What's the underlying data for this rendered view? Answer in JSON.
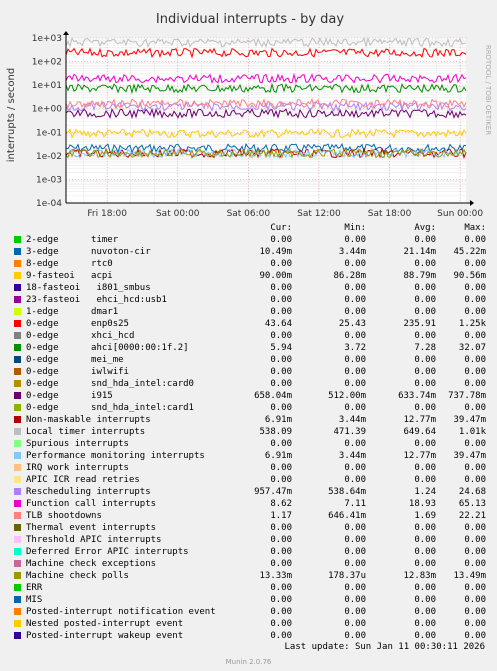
{
  "chart_data": {
    "type": "line",
    "title": "Individual interrupts - by day",
    "ylabel": "interrupts / second",
    "yscale": "log",
    "ylim": [
      0.0001,
      1000
    ],
    "ytick_labels": [
      "1e+03",
      "1e+02",
      "1e+01",
      "1e+00",
      "1e-01",
      "1e-02",
      "1e-03",
      "1e-04"
    ],
    "ytick_values": [
      1000,
      100,
      10,
      1,
      0.1,
      0.01,
      0.001,
      0.0001
    ],
    "xtick_labels": [
      "Fri 18:00",
      "Sat 00:00",
      "Sat 06:00",
      "Sat 12:00",
      "Sat 18:00",
      "Sun 00:00"
    ],
    "xtick_hours": [
      18,
      24,
      30,
      36,
      42,
      48
    ],
    "x_range_hours": [
      14.5,
      48.5
    ],
    "side_text": "RRDTOOL / TOBI OETIKER",
    "grid": true,
    "legend_header": {
      "cur": "Cur:",
      "min": "Min:",
      "avg": "Avg:",
      "max": "Max:"
    },
    "series": [
      {
        "name": "2-edge      timer",
        "color": "#00cc00",
        "cur": "0.00",
        "min": "0.00",
        "avg": "0.00",
        "max": "0.00",
        "value": 0
      },
      {
        "name": "3-edge      nuvoton-cir",
        "color": "#0066b3",
        "cur": "10.49m",
        "min": "3.44m",
        "avg": "21.14m",
        "max": "45.22m",
        "value": 0.021
      },
      {
        "name": "8-edge      rtc0",
        "color": "#ff8000",
        "cur": "0.00",
        "min": "0.00",
        "avg": "0.00",
        "max": "0.00",
        "value": 0
      },
      {
        "name": "9-fasteoi   acpi",
        "color": "#ffcc00",
        "cur": "90.00m",
        "min": "86.28m",
        "avg": "88.79m",
        "max": "90.56m",
        "value": 0.089
      },
      {
        "name": "18-fasteoi   i801_smbus",
        "color": "#330099",
        "cur": "0.00",
        "min": "0.00",
        "avg": "0.00",
        "max": "0.00",
        "value": 0
      },
      {
        "name": "23-fasteoi   ehci_hcd:usb1",
        "color": "#990099",
        "cur": "0.00",
        "min": "0.00",
        "avg": "0.00",
        "max": "0.00",
        "value": 0
      },
      {
        "name": "1-edge      dmar1",
        "color": "#ccff00",
        "cur": "0.00",
        "min": "0.00",
        "avg": "0.00",
        "max": "0.00",
        "value": 0
      },
      {
        "name": "0-edge      enp0s25",
        "color": "#ff0000",
        "cur": "43.64",
        "min": "25.43",
        "avg": "235.91",
        "max": "1.25k",
        "value": 235.91
      },
      {
        "name": "0-edge      xhci_hcd",
        "color": "#808080",
        "cur": "0.00",
        "min": "0.00",
        "avg": "0.00",
        "max": "0.00",
        "value": 0
      },
      {
        "name": "0-edge      ahci[0000:00:1f.2]",
        "color": "#008f00",
        "cur": "5.94",
        "min": "3.72",
        "avg": "7.28",
        "max": "32.07",
        "value": 7.28
      },
      {
        "name": "0-edge      mei_me",
        "color": "#00487d",
        "cur": "0.00",
        "min": "0.00",
        "avg": "0.00",
        "max": "0.00",
        "value": 0
      },
      {
        "name": "0-edge      iwlwifi",
        "color": "#b35a00",
        "cur": "0.00",
        "min": "0.00",
        "avg": "0.00",
        "max": "0.00",
        "value": 0
      },
      {
        "name": "0-edge      snd_hda_intel:card0",
        "color": "#b38f00",
        "cur": "0.00",
        "min": "0.00",
        "avg": "0.00",
        "max": "0.00",
        "value": 0
      },
      {
        "name": "0-edge      i915",
        "color": "#6b006b",
        "cur": "658.04m",
        "min": "512.00m",
        "avg": "633.74m",
        "max": "737.78m",
        "value": 0.634
      },
      {
        "name": "0-edge      snd_hda_intel:card1",
        "color": "#8fb300",
        "cur": "0.00",
        "min": "0.00",
        "avg": "0.00",
        "max": "0.00",
        "value": 0
      },
      {
        "name": "Non-maskable interrupts",
        "color": "#b30000",
        "cur": "6.91m",
        "min": "3.44m",
        "avg": "12.77m",
        "max": "39.47m",
        "value": 0.0128
      },
      {
        "name": "Local timer interrupts",
        "color": "#bebebe",
        "cur": "538.09",
        "min": "471.39",
        "avg": "649.64",
        "max": "1.01k",
        "value": 649.64
      },
      {
        "name": "Spurious interrupts",
        "color": "#80ff80",
        "cur": "0.00",
        "min": "0.00",
        "avg": "0.00",
        "max": "0.00",
        "value": 0
      },
      {
        "name": "Performance monitoring interrupts",
        "color": "#80c9ff",
        "cur": "6.91m",
        "min": "3.44m",
        "avg": "12.77m",
        "max": "39.47m",
        "value": 0.0128
      },
      {
        "name": "IRQ work interrupts",
        "color": "#ffc080",
        "cur": "0.00",
        "min": "0.00",
        "avg": "0.00",
        "max": "0.00",
        "value": 0
      },
      {
        "name": "APIC ICR read retries",
        "color": "#ffe680",
        "cur": "0.00",
        "min": "0.00",
        "avg": "0.00",
        "max": "0.00",
        "value": 0
      },
      {
        "name": "Rescheduling interrupts",
        "color": "#aa80ff",
        "cur": "957.47m",
        "min": "538.64m",
        "avg": "1.24",
        "max": "24.68",
        "value": 1.24
      },
      {
        "name": "Function call interrupts",
        "color": "#ee00cc",
        "cur": "8.62",
        "min": "7.11",
        "avg": "18.93",
        "max": "65.13",
        "value": 18.93
      },
      {
        "name": "TLB shootdowns",
        "color": "#ff8080",
        "cur": "1.17",
        "min": "646.41m",
        "avg": "1.69",
        "max": "22.21",
        "value": 1.69
      },
      {
        "name": "Thermal event interrupts",
        "color": "#666600",
        "cur": "0.00",
        "min": "0.00",
        "avg": "0.00",
        "max": "0.00",
        "value": 0
      },
      {
        "name": "Threshold APIC interrupts",
        "color": "#ffbfff",
        "cur": "0.00",
        "min": "0.00",
        "avg": "0.00",
        "max": "0.00",
        "value": 0
      },
      {
        "name": "Deferred Error APIC interrupts",
        "color": "#00ffcc",
        "cur": "0.00",
        "min": "0.00",
        "avg": "0.00",
        "max": "0.00",
        "value": 0
      },
      {
        "name": "Machine check exceptions",
        "color": "#cc6699",
        "cur": "0.00",
        "min": "0.00",
        "avg": "0.00",
        "max": "0.00",
        "value": 0
      },
      {
        "name": "Machine check polls",
        "color": "#999900",
        "cur": "13.33m",
        "min": "178.37u",
        "avg": "12.83m",
        "max": "13.49m",
        "value": 0.0128
      },
      {
        "name": "ERR",
        "color": "#00cc00",
        "cur": "0.00",
        "min": "0.00",
        "avg": "0.00",
        "max": "0.00",
        "value": 0
      },
      {
        "name": "MIS",
        "color": "#0066b3",
        "cur": "0.00",
        "min": "0.00",
        "avg": "0.00",
        "max": "0.00",
        "value": 0
      },
      {
        "name": "Posted-interrupt notification event",
        "color": "#ff8000",
        "cur": "0.00",
        "min": "0.00",
        "avg": "0.00",
        "max": "0.00",
        "value": 0
      },
      {
        "name": "Nested posted-interrupt event",
        "color": "#ffcc00",
        "cur": "0.00",
        "min": "0.00",
        "avg": "0.00",
        "max": "0.00",
        "value": 0
      },
      {
        "name": "Posted-interrupt wakeup event",
        "color": "#330099",
        "cur": "0.00",
        "min": "0.00",
        "avg": "0.00",
        "max": "0.00",
        "value": 0
      }
    ]
  },
  "footer": {
    "last_update": "Last update: Sun Jan 11 00:30:11 2026",
    "munin_version": "Munin 2.0.76"
  }
}
